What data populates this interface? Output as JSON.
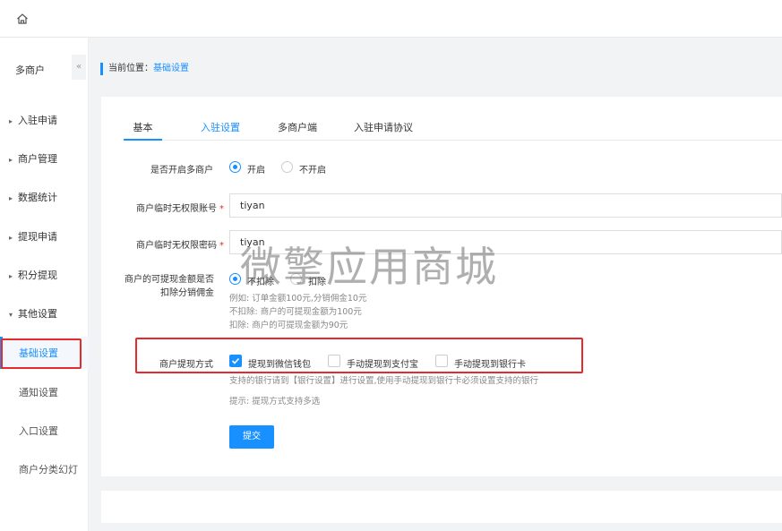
{
  "topbar": {
    "home_icon": "home-icon"
  },
  "sidebar": {
    "title": "多商户",
    "collapse_label": "«",
    "groups": [
      {
        "label": "入驻申请",
        "caret": "▸"
      },
      {
        "label": "商户管理",
        "caret": "▸"
      },
      {
        "label": "数据统计",
        "caret": "▸"
      },
      {
        "label": "提现申请",
        "caret": "▸"
      },
      {
        "label": "积分提现",
        "caret": "▸"
      },
      {
        "label": "其他设置",
        "caret": "▾"
      }
    ],
    "subitems": [
      {
        "label": "基础设置",
        "active": true
      },
      {
        "label": "通知设置"
      },
      {
        "label": "入口设置"
      },
      {
        "label": "商户分类幻灯"
      }
    ]
  },
  "breadcrumb": {
    "prefix": "当前位置：",
    "current": "基础设置"
  },
  "tabs": [
    {
      "label": "基本"
    },
    {
      "label": "入驻设置"
    },
    {
      "label": "多商户端"
    },
    {
      "label": "入驻申请协议"
    }
  ],
  "form": {
    "enable": {
      "label": "是否开启多商户",
      "options": [
        "开启",
        "不开启"
      ],
      "selected": "开启"
    },
    "account": {
      "label": "商户临时无权限账号",
      "required_mark": "*",
      "value": "tiyan"
    },
    "password": {
      "label": "商户临时无权限密码",
      "required_mark": "*",
      "value": "tiyan"
    },
    "deduct": {
      "label_line1": "商户的可提现金额是否",
      "label_line2": "扣除分销佣金",
      "options": [
        "不扣除",
        "扣除"
      ],
      "selected": "不扣除",
      "help": [
        "例如: 订单金额100元,分销佣金10元",
        "不扣除: 商户的可提现金额为100元",
        "扣除: 商户的可提现金额为90元"
      ]
    },
    "withdraw": {
      "label": "商户提现方式",
      "options": [
        {
          "label": "提现到微信钱包",
          "checked": true
        },
        {
          "label": "手动提现到支付宝",
          "checked": false
        },
        {
          "label": "手动提现到银行卡",
          "checked": false
        }
      ],
      "help1": "支持的银行请到【银行设置】进行设置,使用手动提现到银行卡必须设置支持的银行",
      "help2": "提示: 提现方式支持多选"
    },
    "submit_label": "提交"
  },
  "watermark": "微擎应用商城",
  "colors": {
    "accent": "#1890ff",
    "highlight": "#e52b2b"
  }
}
